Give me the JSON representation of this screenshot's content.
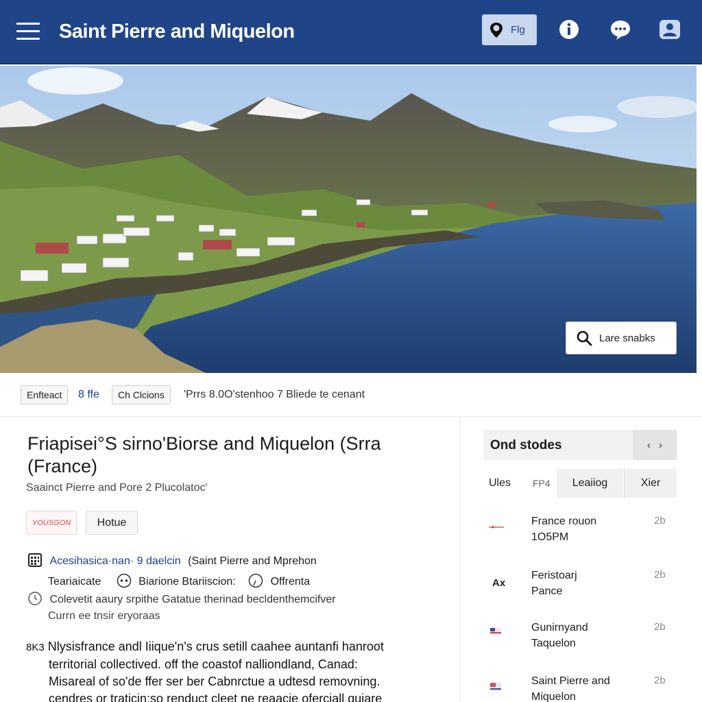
{
  "header": {
    "title": "Saint Pierre and Miquelon",
    "flag_label": "Flg",
    "icons": [
      "menu-icon",
      "location-pin-icon",
      "info-icon",
      "chat-icon",
      "profile-icon"
    ],
    "color_bg": "#1f4488"
  },
  "hero": {
    "search_label": "Lare snabks"
  },
  "filter_strip": {
    "chip1": "Enfteact",
    "link": "8 ffe",
    "chip2": "Ch Clcions",
    "text": "'Prrs 8.0O'stenhoo 7 Bliede te cenant"
  },
  "article": {
    "title": "Friapisei°S sirno'Biorse and Miquelon (Srra (France)",
    "subtitle": "Saainct Pierre and Pore 2 Plucolatoc'",
    "tag_red": "YOUSGON",
    "tag_plain": "Hotue",
    "info_line1": "Acesihasica·nan· 9  daelcin",
    "info_line1_rest": "(Saint Pierre and Mprehon",
    "info_line2_a": "Teariaicate",
    "info_line2_b": "Biarione Btariiscion:",
    "info_line2_c": "Offrenta",
    "info_line3": "Colevetit aaury srpithe Gatatue therinad becldenthemcifver",
    "info_line4": "Currn ee tnsir eryoraas",
    "para_prefix": "8K3",
    "para_line1": "Nlysisfrance andl Iiique'n's crus setill caahee auntanfi hanroot",
    "para_line2": "territorial collectived. off the coastof nalliondland, Canad:",
    "para_line3": "Misareal of so'de ffer ser ber Cabnrctue a udtesd removning.",
    "para_line4": "cendres or traticin:so renduct cleet ne reaacie oferciall guiare"
  },
  "sidebar": {
    "title": "Ond stodes",
    "nav_prev": "‹",
    "nav_next": "›",
    "tabs": [
      "Ules",
      "FP4",
      "Leaiiog",
      "Xier"
    ],
    "items": [
      {
        "thumb": "—•—",
        "line1": "France rouon",
        "line2": "1O5PM",
        "num": "2b"
      },
      {
        "thumb": "Ax",
        "line1": "Feristoarj",
        "line2": "Pance",
        "num": "2b"
      },
      {
        "thumb": "flag",
        "line1": "Gunirnyand",
        "line2": "Taquelon",
        "num": "2b"
      },
      {
        "thumb": "flag",
        "line1": "Saint Pierre and",
        "line2": "Miquelon",
        "num": "2b"
      }
    ]
  }
}
